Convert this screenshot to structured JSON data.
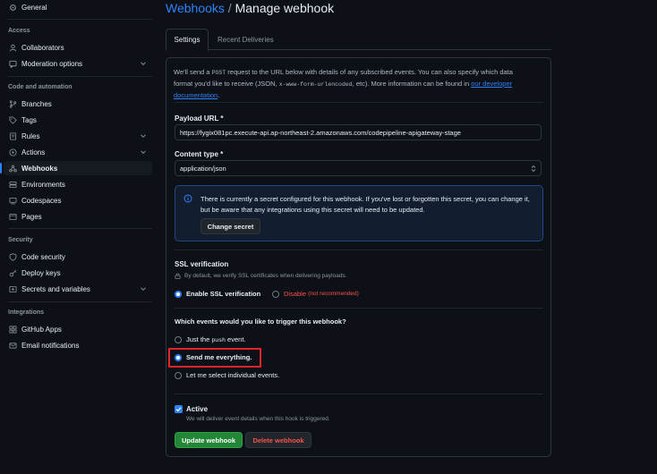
{
  "sidebar": {
    "general": "General",
    "sections": {
      "access": "Access",
      "code_automation": "Code and automation",
      "security": "Security",
      "integrations": "Integrations"
    },
    "items": {
      "collaborators": "Collaborators",
      "moderation": "Moderation options",
      "branches": "Branches",
      "tags": "Tags",
      "rules": "Rules",
      "actions": "Actions",
      "webhooks": "Webhooks",
      "environments": "Environments",
      "codespaces": "Codespaces",
      "pages": "Pages",
      "code_security": "Code security",
      "deploy_keys": "Deploy keys",
      "secrets": "Secrets and variables",
      "github_apps": "GitHub Apps",
      "email_notifications": "Email notifications"
    },
    "active_item": "Webhooks"
  },
  "header": {
    "breadcrumb": "Webhooks",
    "separator": "/",
    "title": "Manage webhook"
  },
  "tabs": {
    "settings": "Settings",
    "recent_deliveries": "Recent Deliveries"
  },
  "form": {
    "intro_part1": "We'll send a ",
    "intro_post": "POST",
    "intro_part2": " request to the URL below with details of any subscribed events. You can also specify which data format you'd like to receive (JSON, ",
    "intro_code": "x-www-form-urlencoded",
    "intro_part3": ", etc). More information can be found in ",
    "intro_link": "our developer documentation",
    "intro_end": ".",
    "payload_label": "Payload URL *",
    "payload_value": "https://fygix081pc.execute-api.ap-northeast-2.amazonaws.com/codepipeline-apigateway-stage",
    "content_type_label": "Content type *",
    "content_type_value": "application/json",
    "secret_notice": "There is currently a secret configured for this webhook. If you've lost or forgotten this secret, you can change it, but be aware that any integrations using this secret will need to be updated.",
    "change_secret": "Change secret",
    "ssl_label": "SSL verification",
    "ssl_note": "By default, we verify SSL certificates when delivering payloads.",
    "ssl_enable": "Enable SSL verification",
    "ssl_disable": "Disable",
    "ssl_disable_note": "(not recommended)",
    "events_label": "Which events would you like to trigger this webhook?",
    "event_push_prefix": "Just the ",
    "event_push_code": "push",
    "event_push_suffix": " event.",
    "event_everything": "Send me everything.",
    "event_individual": "Let me select individual events.",
    "active_label": "Active",
    "active_note": "We will deliver event details when this hook is triggered.",
    "update_button": "Update webhook",
    "delete_button": "Delete webhook"
  },
  "colors": {
    "accent": "#2f81f7",
    "success": "#238636",
    "danger": "#f85149",
    "highlight": "#e5232b"
  }
}
